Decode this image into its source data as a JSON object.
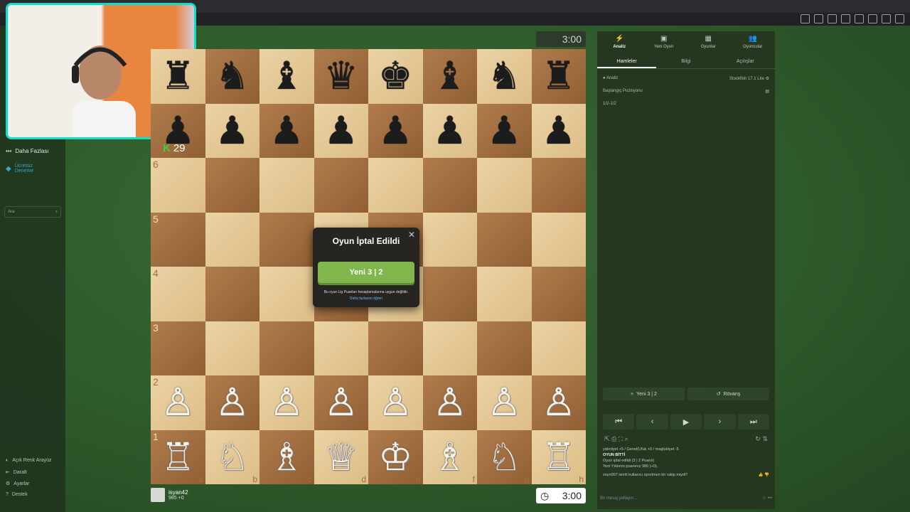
{
  "browser": {
    "title": ""
  },
  "leftnav": {
    "more": "Daha Fazlası",
    "trial_line1": "Ücretsiz",
    "trial_line2": "Deneme",
    "search_placeholder": "Ara",
    "bottom": [
      "Açık Renk Arayüz",
      "Daralt",
      "Ayarlar",
      "Destek"
    ]
  },
  "game": {
    "top_clock": "3:00",
    "bottom_clock": "3:00",
    "opponent_score": "29",
    "player_name": "isyan42",
    "player_rating": "985",
    "player_delta": "+0",
    "ranks": [
      "6",
      "5",
      "4",
      "3",
      "2",
      "1"
    ],
    "files": [
      "a",
      "b",
      "c",
      "d",
      "e",
      "f",
      "g",
      "h"
    ]
  },
  "modal": {
    "title": "Oyun İptal Edildi",
    "button": "Yeni 3 | 2",
    "note": "Bu oyun Lig Puanları hesaplamalarına uygun değildir.",
    "link": "Daha fazlasını öğren"
  },
  "panel": {
    "tabs": [
      {
        "label": "Analiz",
        "icon": "⚡"
      },
      {
        "label": "Yeni Oyun",
        "icon": "▣"
      },
      {
        "label": "Oyunlar",
        "icon": "▦"
      },
      {
        "label": "Oyuncular",
        "icon": "👥"
      }
    ],
    "subtabs": [
      "Hamleler",
      "Bilgi",
      "Açılışlar"
    ],
    "analysis_label": "Analiz",
    "engine": "Stockfish 17.1 Lite",
    "start_position": "Başlangıç Pozisyonu",
    "result": "1/2-1/2",
    "new_game": "Yeni 3 | 2",
    "rematch": "Rövanş",
    "chat": [
      "yatırdyet +5 / Genel(Ufuk +0 / maglubiyet -5",
      "OYUN BİTTİ",
      "Oyun iptal edildi (3 | 2 Puanlı)",
      "Yeni Yıldırım puanınız 985 (+0).",
      "zeyn007 isimli kullanıcı sportmen bir rakip miydi?"
    ],
    "chat_placeholder": "Bir mesaj yollayın..."
  }
}
